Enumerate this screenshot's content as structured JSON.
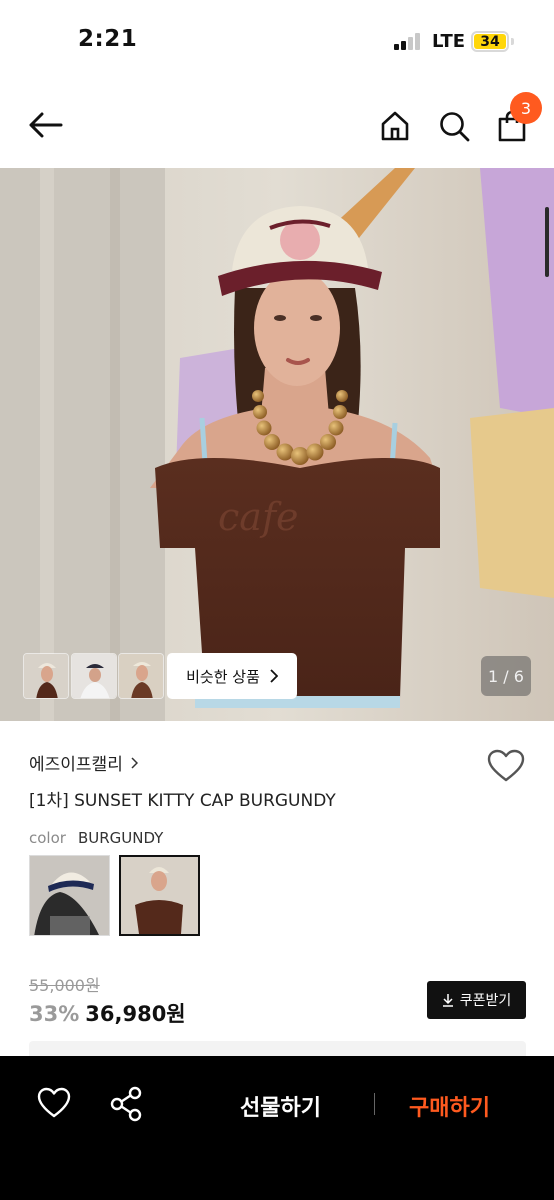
{
  "status_bar": {
    "time": "2:21",
    "network": "LTE",
    "battery": "34",
    "battery_color": "#ffd60a"
  },
  "header": {
    "back_icon": "arrow-left-icon",
    "home_icon": "home-icon",
    "search_icon": "search-icon",
    "bag_icon": "shopping-bag-icon",
    "cart_count": "3",
    "badge_color": "#ff5a1f"
  },
  "gallery": {
    "similar_label": "비슷한 상품",
    "page_indicator": "1 / 6",
    "current_page": 1,
    "total_pages": 6
  },
  "product": {
    "brand": "에즈이프캘리",
    "title": "[1차] SUNSET KITTY CAP BURGUNDY",
    "color_label": "color",
    "color_value": "BURGUNDY",
    "original_price": "55,000원",
    "discount": "33%",
    "final_price": "36,980원",
    "coupon_label": "쿠폰받기"
  },
  "bottom_bar": {
    "gift_label": "선물하기",
    "buy_label": "구매하기",
    "accent_color": "#ff5a1f"
  }
}
